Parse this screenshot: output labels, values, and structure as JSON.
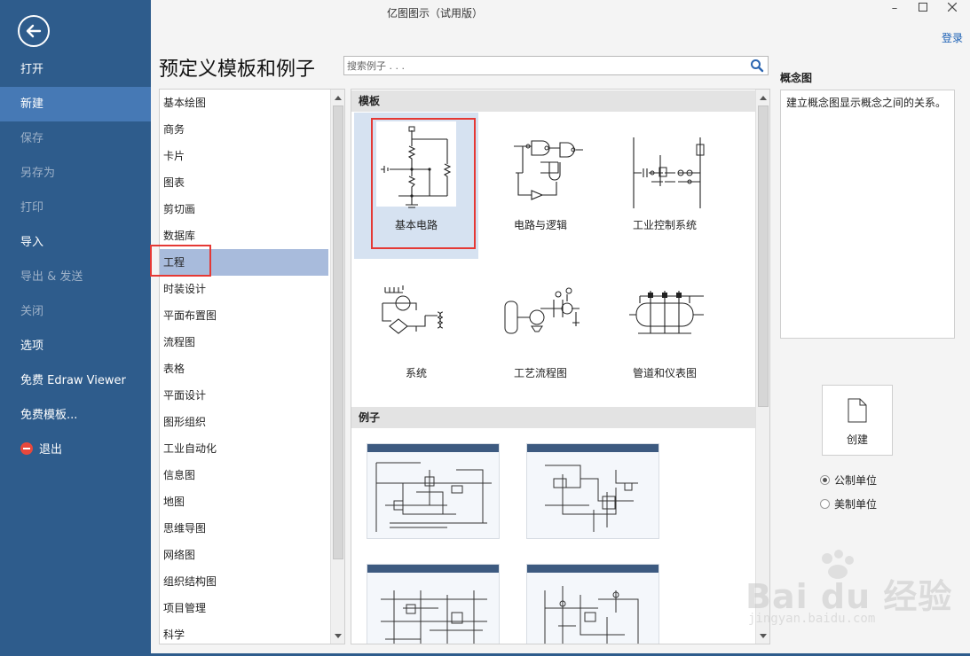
{
  "app": {
    "title": "亿图图示（试用版）",
    "login": "登录"
  },
  "sidebar": {
    "items": [
      {
        "label": "打开",
        "state": "normal"
      },
      {
        "label": "新建",
        "state": "active"
      },
      {
        "label": "保存",
        "state": "disabled"
      },
      {
        "label": "另存为",
        "state": "disabled"
      },
      {
        "label": "打印",
        "state": "disabled"
      },
      {
        "label": "导入",
        "state": "normal"
      },
      {
        "label": "导出 & 发送",
        "state": "disabled"
      },
      {
        "label": "关闭",
        "state": "disabled"
      },
      {
        "label": "选项",
        "state": "normal"
      },
      {
        "label": "免费 Edraw Viewer",
        "state": "normal"
      },
      {
        "label": "免费模板...",
        "state": "normal"
      },
      {
        "label": "退出",
        "state": "normal",
        "icon": "exit-icon"
      }
    ]
  },
  "main": {
    "heading": "预定义模板和例子",
    "search": {
      "placeholder": "搜索例子 . . ."
    }
  },
  "categories": {
    "selected": "工程",
    "items": [
      "基本绘图",
      "商务",
      "卡片",
      "图表",
      "剪切画",
      "数据库",
      "工程",
      "时装设计",
      "平面布置图",
      "流程图",
      "表格",
      "平面设计",
      "图形组织",
      "工业自动化",
      "信息图",
      "地图",
      "思维导图",
      "网络图",
      "组织结构图",
      "项目管理",
      "科学"
    ]
  },
  "templates": {
    "section_label": "模板",
    "items": [
      {
        "label": "基本电路",
        "selected": true
      },
      {
        "label": "电路与逻辑",
        "selected": false
      },
      {
        "label": "工业控制系统",
        "selected": false
      },
      {
        "label": "系统",
        "selected": false
      },
      {
        "label": "工艺流程图",
        "selected": false
      },
      {
        "label": "管道和仪表图",
        "selected": false
      }
    ]
  },
  "examples": {
    "section_label": "例子"
  },
  "right_pane": {
    "desc_title": "概念图",
    "description": "建立概念图显示概念之间的关系。",
    "create_label": "创建",
    "units": [
      {
        "label": "公制单位",
        "checked": true
      },
      {
        "label": "美制单位",
        "checked": false
      }
    ]
  },
  "watermark": {
    "text": "Bai du 经验",
    "sub": "jingyan.baidu.com"
  },
  "colors": {
    "sidebar": "#2e5c8c",
    "sidebar_active": "#4679b5",
    "category_selected": "#a8bbdc",
    "template_selected": "#d6e2f1",
    "highlight": "#e53935",
    "link": "#1a5fb4"
  }
}
